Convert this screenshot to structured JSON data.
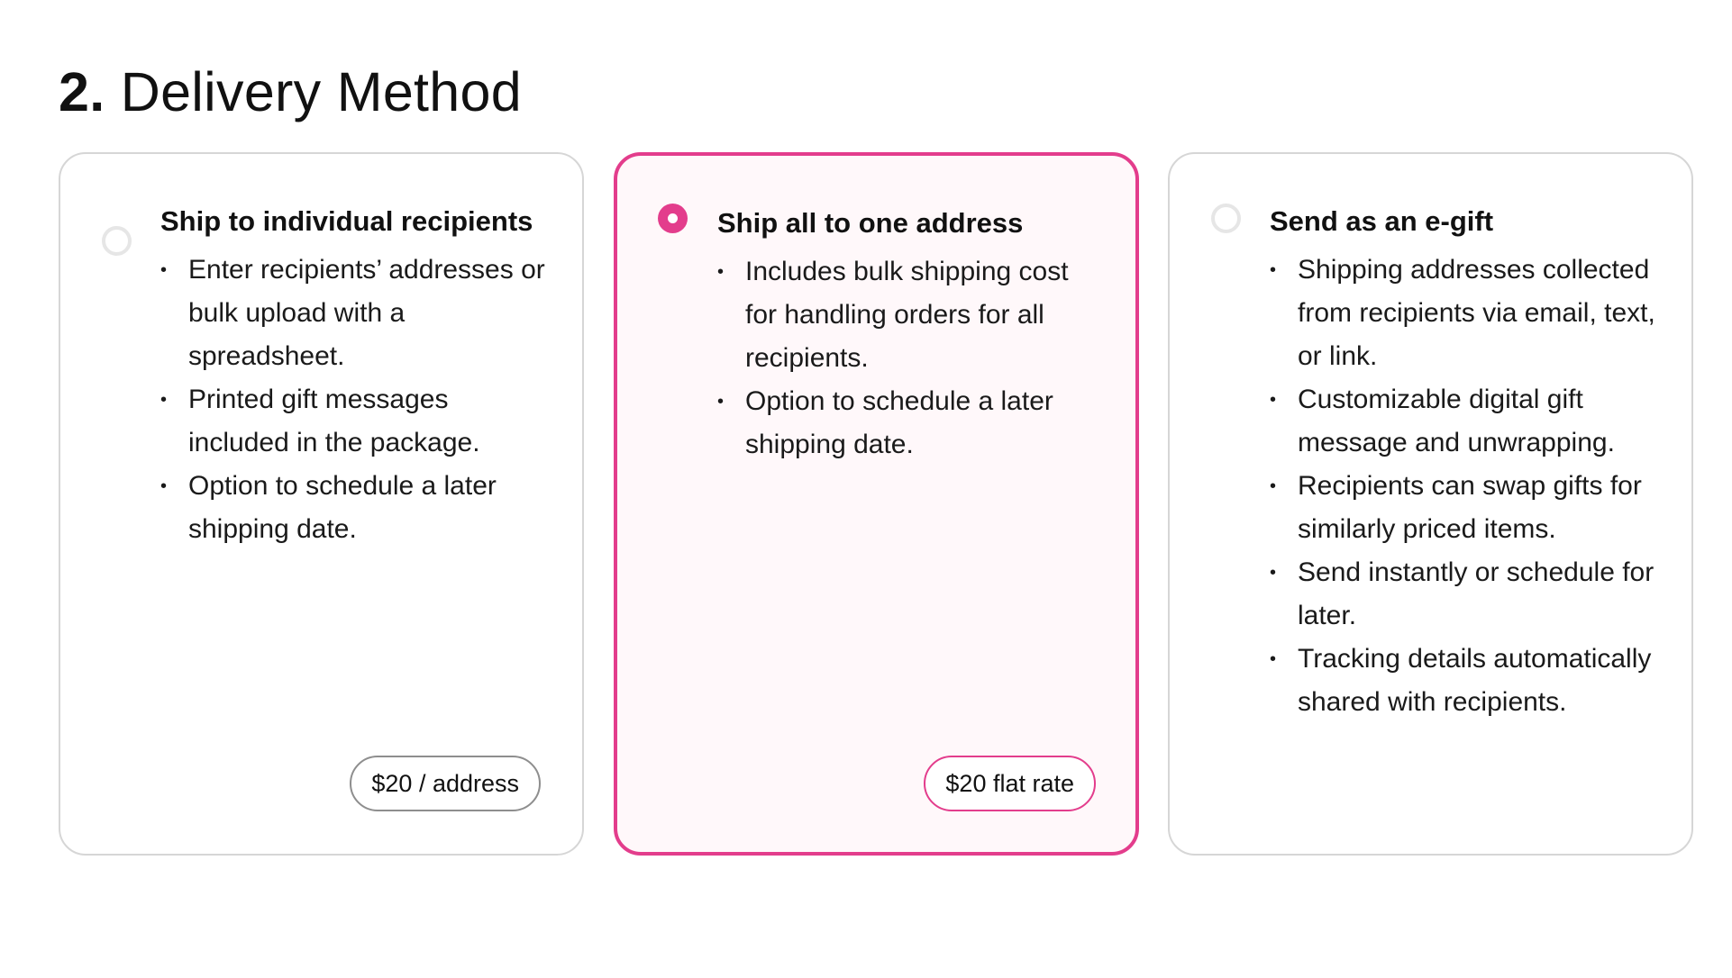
{
  "header": {
    "step_number": "2.",
    "title": "Delivery Method"
  },
  "options": [
    {
      "title": "Ship to individual recipients",
      "selected": false,
      "bullets": [
        "Enter recipients’ addresses or bulk upload with a spreadsheet.",
        "Printed gift messages included in the package.",
        "Option to schedule a later shipping date."
      ],
      "price": "$20 / address"
    },
    {
      "title": "Ship all to one address",
      "selected": true,
      "bullets": [
        "Includes bulk shipping cost for handling orders for all recipients.",
        "Option to schedule a later shipping date."
      ],
      "price": "$20 flat rate"
    },
    {
      "title": "Send as an e-gift",
      "selected": false,
      "bullets": [
        "Shipping addresses collected from recipients via email, text, or link.",
        "Customizable digital gift message and unwrapping.",
        "Recipients can swap gifts for similarly priced items.",
        "Send instantly or schedule for later.",
        "Tracking details automatically shared with recipients."
      ],
      "price": null
    }
  ],
  "colors": {
    "accent": "#e33d8c",
    "selected_background": "#fff8fa",
    "card_border": "#d6d6d6",
    "radio_unselected": "#e6e6e6"
  }
}
